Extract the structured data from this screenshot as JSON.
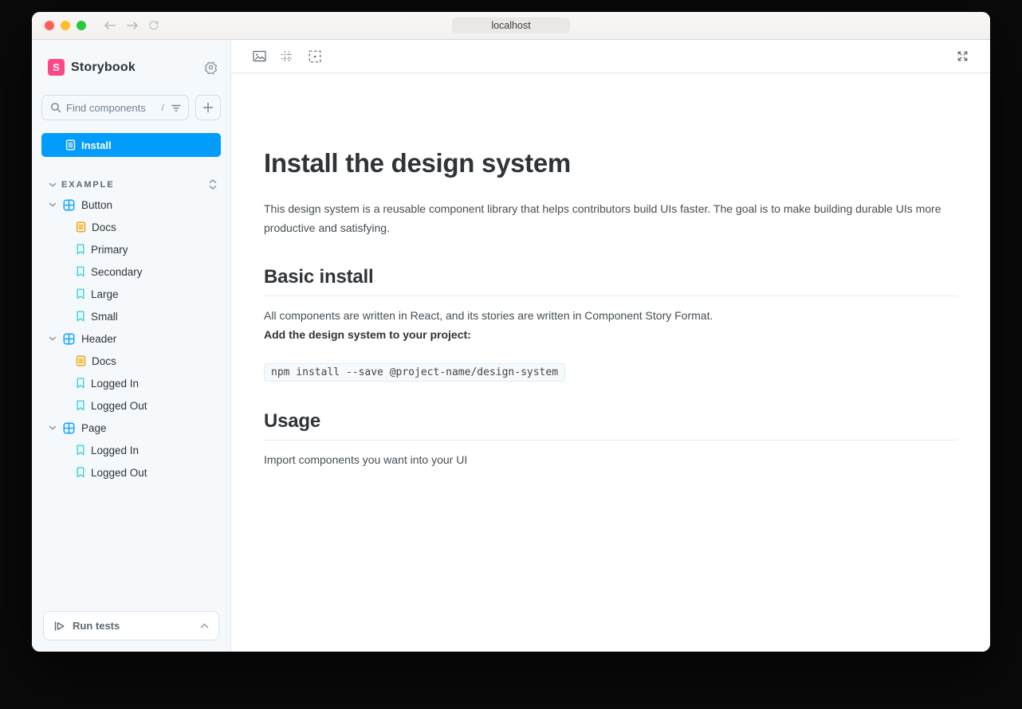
{
  "browser": {
    "url": "localhost",
    "traffic_lights": {
      "close": "#ff5f57",
      "minimize": "#febc2e",
      "zoom": "#28c840"
    }
  },
  "sidebar": {
    "brand": {
      "logo_letter": "S",
      "name": "Storybook"
    },
    "search": {
      "placeholder": "Find components",
      "shortcut": "/"
    },
    "selected": {
      "label": "Install"
    },
    "section": {
      "label": "EXAMPLE"
    },
    "tree": [
      {
        "label": "Button",
        "type": "component",
        "icon": "component-icon",
        "expanded": true
      },
      {
        "label": "Docs",
        "type": "docs",
        "icon": "docs-icon"
      },
      {
        "label": "Primary",
        "type": "story",
        "icon": "bookmark-icon"
      },
      {
        "label": "Secondary",
        "type": "story",
        "icon": "bookmark-icon"
      },
      {
        "label": "Large",
        "type": "story",
        "icon": "bookmark-icon"
      },
      {
        "label": "Small",
        "type": "story",
        "icon": "bookmark-icon"
      },
      {
        "label": "Header",
        "type": "component",
        "icon": "component-icon",
        "expanded": true
      },
      {
        "label": "Docs",
        "type": "docs",
        "icon": "docs-icon"
      },
      {
        "label": "Logged In",
        "type": "story",
        "icon": "bookmark-icon"
      },
      {
        "label": "Logged Out",
        "type": "story",
        "icon": "bookmark-icon"
      },
      {
        "label": "Page",
        "type": "component",
        "icon": "component-icon",
        "expanded": true
      },
      {
        "label": "Logged In",
        "type": "story",
        "icon": "bookmark-icon"
      },
      {
        "label": "Logged Out",
        "type": "story",
        "icon": "bookmark-icon"
      }
    ],
    "run_tests": {
      "label": "Run tests",
      "icon": "run-tests-play-icon",
      "chevron": "chevron-up-icon"
    }
  },
  "canvas_toolbar": {
    "icons": [
      "background-image-icon",
      "grid-icon",
      "outline-icon"
    ],
    "right_icon": "fullscreen-expand-icon"
  },
  "content": {
    "title": "Install the design system",
    "intro": "This design system is a reusable component library that helps contributors build UIs faster. The goal is to make building durable UIs more productive and satisfying.",
    "sections": [
      {
        "heading": "Basic install",
        "paragraph": "All components are written in React, and its stories are written in Component Story Format.",
        "bold_line": "Add the design system to your project:",
        "code": "npm install --save @project-name/design-system"
      },
      {
        "heading": "Usage",
        "paragraph": "Import components you want into your UI"
      }
    ]
  },
  "colors": {
    "accent_blue": "#029cfd",
    "brand_pink": "#ff4785",
    "docs_orange": "#e69d00",
    "story_teal": "#37d5d3",
    "sidebar_bg": "#f6f9fc",
    "text_dark": "#2e3438"
  }
}
